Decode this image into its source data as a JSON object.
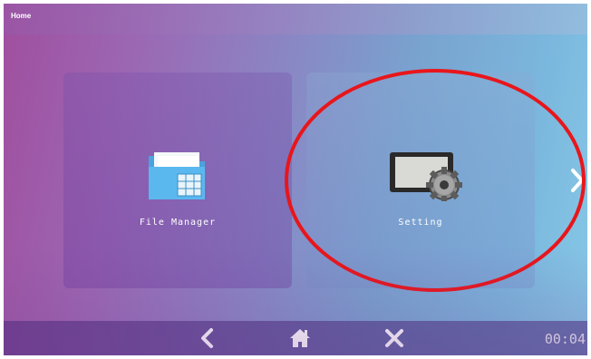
{
  "header": {
    "title": "Home"
  },
  "tiles": [
    {
      "label": "File Manager",
      "icon": "folder-icon"
    },
    {
      "label": "Setting",
      "icon": "settings-gear-icon"
    }
  ],
  "footer": {
    "clock": "00:04"
  },
  "icons": {
    "next": "chevron-right-icon",
    "back": "chevron-left-icon",
    "home": "home-icon",
    "close": "close-icon"
  },
  "colors": {
    "highlight": "#e8161b",
    "text": "#ffffff"
  }
}
